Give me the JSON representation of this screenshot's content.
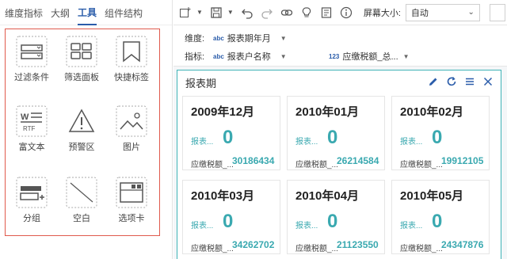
{
  "left_tabs": [
    "维度指标",
    "大纲",
    "工具",
    "组件结构"
  ],
  "components": [
    {
      "label": "过滤条件",
      "icon": "filter-condition-icon"
    },
    {
      "label": "筛选面板",
      "icon": "filter-panel-icon"
    },
    {
      "label": "快捷标签",
      "icon": "bookmark-icon"
    },
    {
      "label": "富文本",
      "icon": "rich-text-icon"
    },
    {
      "label": "预警区",
      "icon": "warning-icon"
    },
    {
      "label": "图片",
      "icon": "image-icon"
    },
    {
      "label": "分组",
      "icon": "group-icon"
    },
    {
      "label": "空白",
      "icon": "blank-icon"
    },
    {
      "label": "选项卡",
      "icon": "tab-card-icon"
    }
  ],
  "toolbar": {
    "screen_size_label": "屏幕大小:",
    "screen_size_value": "自动"
  },
  "fields": {
    "dimension_label": "维度:",
    "dimension_tag": "abc",
    "dimension_value": "报表期年月",
    "metric_label": "指标:",
    "metric_tag": "abc",
    "metric_value": "报表户名称",
    "metric2_tag": "123",
    "metric2_value": "应缴税额_总..."
  },
  "panel": {
    "title": "报表期",
    "cards": [
      {
        "title": "2009年12月",
        "sub": "报表...",
        "big": "0",
        "foot_k": "应缴税额_...",
        "foot_v": "30186434"
      },
      {
        "title": "2010年01月",
        "sub": "报表...",
        "big": "0",
        "foot_k": "应缴税额_...",
        "foot_v": "26214584"
      },
      {
        "title": "2010年02月",
        "sub": "报表...",
        "big": "0",
        "foot_k": "应缴税额_...",
        "foot_v": "19912105"
      },
      {
        "title": "2010年03月",
        "sub": "报表...",
        "big": "0",
        "foot_k": "应缴税额_...",
        "foot_v": "34262702"
      },
      {
        "title": "2010年04月",
        "sub": "报表...",
        "big": "0",
        "foot_k": "应缴税额_...",
        "foot_v": "21123550"
      },
      {
        "title": "2010年05月",
        "sub": "报表...",
        "big": "0",
        "foot_k": "应缴税额_...",
        "foot_v": "24347876"
      }
    ]
  },
  "colors": {
    "accent": "#2a5caa",
    "teal": "#3aa9b0",
    "highlight_border": "#e05a4d"
  }
}
